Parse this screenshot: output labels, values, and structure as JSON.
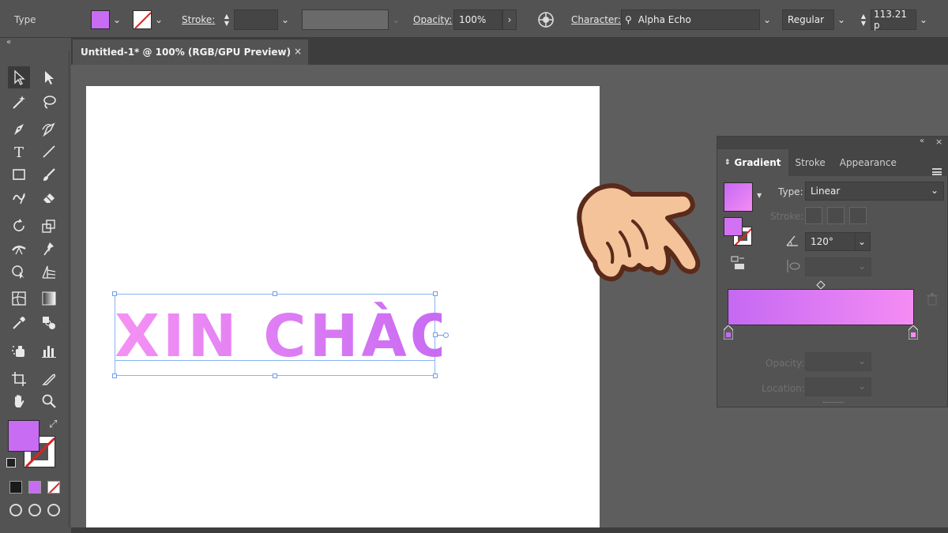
{
  "control_bar": {
    "type_label": "Type",
    "fill_color": "#c86cf3",
    "stroke_label": "Stroke:",
    "opacity_label": "Opacity:",
    "opacity_value": "100%",
    "character_label": "Character:",
    "font_name": "Alpha Echo",
    "font_style": "Regular",
    "font_size": "113.21 p"
  },
  "document": {
    "tab_title": "Untitled-1* @ 100% (RGB/GPU Preview)",
    "close_glyph": "×"
  },
  "artboard": {
    "text": "XIN CHÀO",
    "gradient_start": "#f591f4",
    "gradient_end": "#c569f3"
  },
  "toolbar": {
    "icons": [
      "selection-icon",
      "direct-selection-icon",
      "magic-wand-icon",
      "lasso-icon",
      "pen-icon",
      "curvature-icon",
      "type-icon",
      "line-icon",
      "rectangle-icon",
      "paintbrush-icon",
      "shaper-icon",
      "eraser-icon",
      "rotate-icon",
      "scale-icon",
      "width-icon",
      "puppet-warp-icon",
      "shape-builder-icon",
      "perspective-grid-icon",
      "mesh-icon",
      "gradient-icon",
      "eyedropper-icon",
      "blend-icon",
      "symbol-sprayer-icon",
      "column-graph-icon",
      "artboard-icon",
      "slice-icon",
      "hand-icon",
      "zoom-icon"
    ],
    "fill_color": "#c86cf3"
  },
  "gradient_panel": {
    "tabs": [
      "Gradient",
      "Stroke",
      "Appearance"
    ],
    "type_label": "Type:",
    "type_value": "Linear",
    "stroke_label": "Stroke:",
    "angle_value": "120°",
    "opacity_label": "Opacity:",
    "location_label": "Location:",
    "swatch_color": "#d272f3",
    "gradient_left": "#c569f3",
    "gradient_right": "#f58cf4"
  }
}
